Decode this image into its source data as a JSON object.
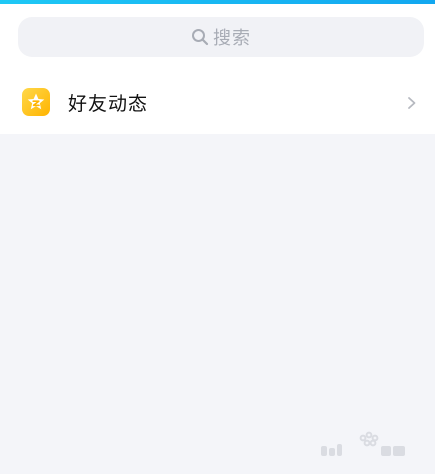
{
  "search": {
    "placeholder": "搜索",
    "icon": "search-icon"
  },
  "list": {
    "items": [
      {
        "label": "好友动态",
        "icon": "star-badge-icon",
        "chevron": "chevron-right-icon"
      }
    ]
  },
  "colors": {
    "accent": "#12a7f0",
    "icon_badge": "#ffc21a",
    "background": "#f4f5f9"
  }
}
